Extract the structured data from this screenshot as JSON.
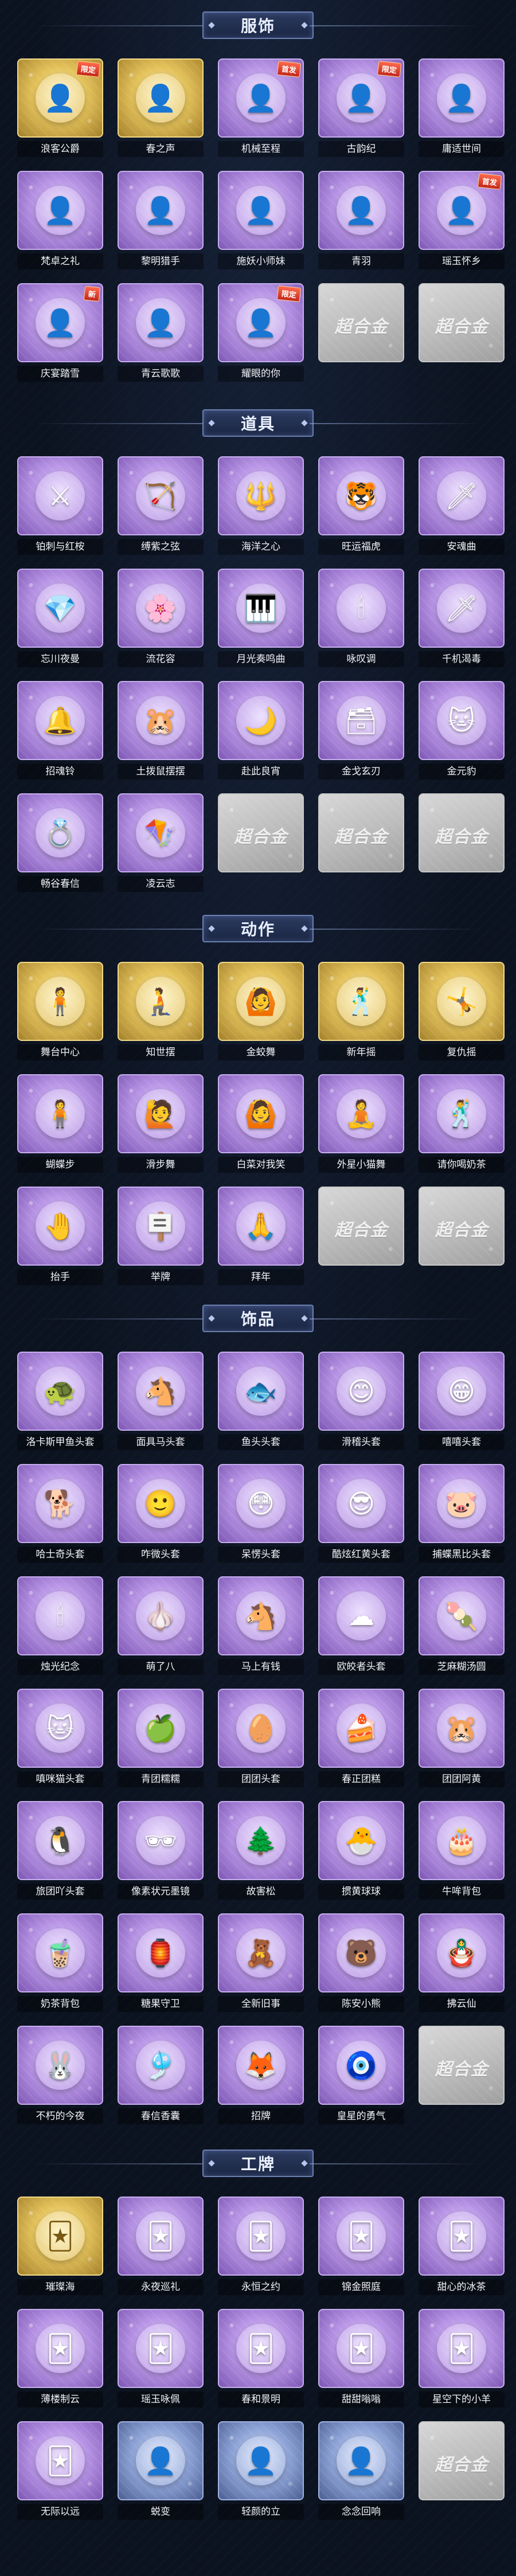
{
  "sections": [
    {
      "title": "服饰",
      "items": [
        {
          "label": "浪客公爵",
          "style": "gold",
          "icon": "👤",
          "badge": "限定"
        },
        {
          "label": "春之声",
          "style": "gold",
          "icon": "👤",
          "badge": ""
        },
        {
          "label": "机械至程",
          "style": "purple",
          "icon": "👤",
          "badge": "首发"
        },
        {
          "label": "古韵纪",
          "style": "purple",
          "icon": "👤",
          "badge": "限定"
        },
        {
          "label": "庸适世间",
          "style": "purple",
          "icon": "👤",
          "badge": ""
        },
        {
          "label": "梵卓之礼",
          "style": "purple",
          "icon": "👤",
          "badge": ""
        },
        {
          "label": "黎明猎手",
          "style": "purple",
          "icon": "👤",
          "badge": ""
        },
        {
          "label": "施妖小师妹",
          "style": "purple",
          "icon": "👤",
          "badge": ""
        },
        {
          "label": "青羽",
          "style": "purple",
          "icon": "👤",
          "badge": ""
        },
        {
          "label": "瑶玉怀乡",
          "style": "purple",
          "icon": "👤",
          "badge": "首发"
        },
        {
          "label": "庆宴踏雪",
          "style": "purple",
          "icon": "👤",
          "badge": "新"
        },
        {
          "label": "青云歌歌",
          "style": "purple",
          "icon": "👤",
          "badge": ""
        },
        {
          "label": "耀眼的你",
          "style": "purple",
          "icon": "👤",
          "badge": "限定"
        },
        {
          "label": "",
          "style": "gray",
          "icon": "",
          "badge": "",
          "placeholder": "超合金"
        },
        {
          "label": "",
          "style": "gray",
          "icon": "",
          "badge": "",
          "placeholder": "超合金"
        }
      ]
    },
    {
      "title": "道具",
      "items": [
        {
          "label": "铂刺与红桉",
          "style": "purple",
          "icon": "⚔",
          "badge": ""
        },
        {
          "label": "缚紫之弦",
          "style": "purple",
          "icon": "🏹",
          "badge": ""
        },
        {
          "label": "海洋之心",
          "style": "purple",
          "icon": "🔱",
          "badge": ""
        },
        {
          "label": "旺运福虎",
          "style": "purple",
          "icon": "🐯",
          "badge": ""
        },
        {
          "label": "安魂曲",
          "style": "purple",
          "icon": "🗡",
          "badge": ""
        },
        {
          "label": "忘川夜曼",
          "style": "purple",
          "icon": "💎",
          "badge": ""
        },
        {
          "label": "流花容",
          "style": "purple",
          "icon": "🌸",
          "badge": ""
        },
        {
          "label": "月光奏鸣曲",
          "style": "purple",
          "icon": "🎹",
          "badge": ""
        },
        {
          "label": "咏叹调",
          "style": "purple",
          "icon": "🕯",
          "badge": ""
        },
        {
          "label": "千机渴毒",
          "style": "purple",
          "icon": "🗡",
          "badge": ""
        },
        {
          "label": "招魂铃",
          "style": "purple",
          "icon": "🔔",
          "badge": ""
        },
        {
          "label": "土拨鼠摆摆",
          "style": "purple",
          "icon": "🐹",
          "badge": ""
        },
        {
          "label": "赴此良宵",
          "style": "purple",
          "icon": "🌙",
          "badge": ""
        },
        {
          "label": "金戈玄刃",
          "style": "purple",
          "icon": "🗃",
          "badge": ""
        },
        {
          "label": "金元豹",
          "style": "purple",
          "icon": "🐱",
          "badge": ""
        },
        {
          "label": "畅谷春信",
          "style": "purple",
          "icon": "💍",
          "badge": ""
        },
        {
          "label": "凌云志",
          "style": "purple",
          "icon": "🪁",
          "badge": ""
        },
        {
          "label": "",
          "style": "gray",
          "icon": "",
          "badge": "",
          "placeholder": "超合金"
        },
        {
          "label": "",
          "style": "gray",
          "icon": "",
          "badge": "",
          "placeholder": "超合金"
        },
        {
          "label": "",
          "style": "gray",
          "icon": "",
          "badge": "",
          "placeholder": "超合金"
        }
      ]
    },
    {
      "title": "动作",
      "items": [
        {
          "label": "舞台中心",
          "style": "gold",
          "icon": "🧍",
          "badge": ""
        },
        {
          "label": "知世摆",
          "style": "gold",
          "icon": "🧎",
          "badge": ""
        },
        {
          "label": "金蛟舞",
          "style": "gold",
          "icon": "🙆",
          "badge": ""
        },
        {
          "label": "新年摇",
          "style": "gold",
          "icon": "🕺",
          "badge": ""
        },
        {
          "label": "复仇摇",
          "style": "gold",
          "icon": "🤸",
          "badge": ""
        },
        {
          "label": "蝴蝶步",
          "style": "purple",
          "icon": "🧍",
          "badge": ""
        },
        {
          "label": "滑步舞",
          "style": "purple",
          "icon": "🙋",
          "badge": ""
        },
        {
          "label": "白菜对我笑",
          "style": "purple",
          "icon": "🙆",
          "badge": ""
        },
        {
          "label": "外星小猫舞",
          "style": "purple",
          "icon": "🧘",
          "badge": ""
        },
        {
          "label": "请你喝奶茶",
          "style": "purple",
          "icon": "🕺",
          "badge": ""
        },
        {
          "label": "抬手",
          "style": "purple",
          "icon": "🤚",
          "badge": ""
        },
        {
          "label": "举牌",
          "style": "purple",
          "icon": "🪧",
          "badge": ""
        },
        {
          "label": "拜年",
          "style": "purple",
          "icon": "🙏",
          "badge": ""
        },
        {
          "label": "",
          "style": "gray",
          "icon": "",
          "badge": "",
          "placeholder": "超合金"
        },
        {
          "label": "",
          "style": "gray",
          "icon": "",
          "badge": "",
          "placeholder": "超合金"
        }
      ]
    },
    {
      "title": "饰品",
      "items": [
        {
          "label": "洛卡斯甲鱼头套",
          "style": "purple",
          "icon": "🐢",
          "badge": ""
        },
        {
          "label": "面具马头套",
          "style": "purple",
          "icon": "🐴",
          "badge": ""
        },
        {
          "label": "鱼头头套",
          "style": "purple",
          "icon": "🐟",
          "badge": ""
        },
        {
          "label": "滑稽头套",
          "style": "purple",
          "icon": "😊",
          "badge": ""
        },
        {
          "label": "嘻嘻头套",
          "style": "purple",
          "icon": "😁",
          "badge": ""
        },
        {
          "label": "哈士奇头套",
          "style": "purple",
          "icon": "🐕",
          "badge": ""
        },
        {
          "label": "咋微头套",
          "style": "purple",
          "icon": "🙂",
          "badge": ""
        },
        {
          "label": "呆愣头套",
          "style": "purple",
          "icon": "😳",
          "badge": ""
        },
        {
          "label": "酷炫红黄头套",
          "style": "purple",
          "icon": "😎",
          "badge": ""
        },
        {
          "label": "捕蝶黑比头套",
          "style": "purple",
          "icon": "🐷",
          "badge": ""
        },
        {
          "label": "烛光纪念",
          "style": "purple",
          "icon": "🕯",
          "badge": ""
        },
        {
          "label": "萌了八",
          "style": "purple",
          "icon": "🧄",
          "badge": ""
        },
        {
          "label": "马上有钱",
          "style": "purple",
          "icon": "🐴",
          "badge": ""
        },
        {
          "label": "欧皎者头套",
          "style": "purple",
          "icon": "☁",
          "badge": ""
        },
        {
          "label": "芝麻糊汤圆",
          "style": "purple",
          "icon": "🍡",
          "badge": ""
        },
        {
          "label": "嗔咪猫头套",
          "style": "purple",
          "icon": "🐱",
          "badge": ""
        },
        {
          "label": "青团糯糯",
          "style": "purple",
          "icon": "🍏",
          "badge": ""
        },
        {
          "label": "团团头套",
          "style": "purple",
          "icon": "🥚",
          "badge": ""
        },
        {
          "label": "春正团糕",
          "style": "purple",
          "icon": "🍰",
          "badge": ""
        },
        {
          "label": "团团阿黄",
          "style": "purple",
          "icon": "🐹",
          "badge": ""
        },
        {
          "label": "旅团吖头套",
          "style": "purple",
          "icon": "🐧",
          "badge": ""
        },
        {
          "label": "像素状元墨镜",
          "style": "purple",
          "icon": "🕶",
          "badge": ""
        },
        {
          "label": "故害松",
          "style": "purple",
          "icon": "🌲",
          "badge": ""
        },
        {
          "label": "掼黄球球",
          "style": "purple",
          "icon": "🐣",
          "badge": ""
        },
        {
          "label": "牛哞背包",
          "style": "purple",
          "icon": "🎂",
          "badge": ""
        },
        {
          "label": "奶茶背包",
          "style": "purple",
          "icon": "🧋",
          "badge": ""
        },
        {
          "label": "糖果守卫",
          "style": "purple",
          "icon": "🏮",
          "badge": ""
        },
        {
          "label": "全新旧事",
          "style": "purple",
          "icon": "🧸",
          "badge": ""
        },
        {
          "label": "陈安小熊",
          "style": "purple",
          "icon": "🐻",
          "badge": ""
        },
        {
          "label": "拂云仙",
          "style": "purple",
          "icon": "🪆",
          "badge": ""
        },
        {
          "label": "不朽的今夜",
          "style": "purple",
          "icon": "🐰",
          "badge": ""
        },
        {
          "label": "春信香囊",
          "style": "purple",
          "icon": "🎐",
          "badge": ""
        },
        {
          "label": "招牌",
          "style": "purple",
          "icon": "🦊",
          "badge": ""
        },
        {
          "label": "皇星的勇气",
          "style": "purple",
          "icon": "🧿",
          "badge": ""
        },
        {
          "label": "",
          "style": "gray",
          "icon": "",
          "badge": "",
          "placeholder": "超合金"
        }
      ]
    },
    {
      "title": "工牌",
      "items": [
        {
          "label": "璀璨海",
          "style": "gold",
          "icon": "🃏",
          "badge": ""
        },
        {
          "label": "永夜巡礼",
          "style": "purple",
          "icon": "🃏",
          "badge": ""
        },
        {
          "label": "永恒之约",
          "style": "purple",
          "icon": "🃏",
          "badge": ""
        },
        {
          "label": "锦金照庭",
          "style": "purple",
          "icon": "🃏",
          "badge": ""
        },
        {
          "label": "甜心的冰茶",
          "style": "purple",
          "icon": "🃏",
          "badge": ""
        },
        {
          "label": "薄楼制云",
          "style": "purple",
          "icon": "🃏",
          "badge": ""
        },
        {
          "label": "瑶玉咏佩",
          "style": "purple",
          "icon": "🃏",
          "badge": ""
        },
        {
          "label": "春和景明",
          "style": "purple",
          "icon": "🃏",
          "badge": ""
        },
        {
          "label": "甜甜嗡嗡",
          "style": "purple",
          "icon": "🃏",
          "badge": ""
        },
        {
          "label": "星空下的小羊",
          "style": "purple",
          "icon": "🃏",
          "badge": ""
        },
        {
          "label": "无际以远",
          "style": "purple",
          "icon": "🃏",
          "badge": ""
        },
        {
          "label": "蜕变",
          "style": "blue",
          "icon": "👤",
          "badge": ""
        },
        {
          "label": "轻颜的立",
          "style": "blue",
          "icon": "👤",
          "badge": ""
        },
        {
          "label": "念念回响",
          "style": "blue",
          "icon": "👤",
          "badge": ""
        },
        {
          "label": "",
          "style": "gray",
          "icon": "",
          "badge": "",
          "placeholder": "超合金"
        }
      ]
    }
  ]
}
